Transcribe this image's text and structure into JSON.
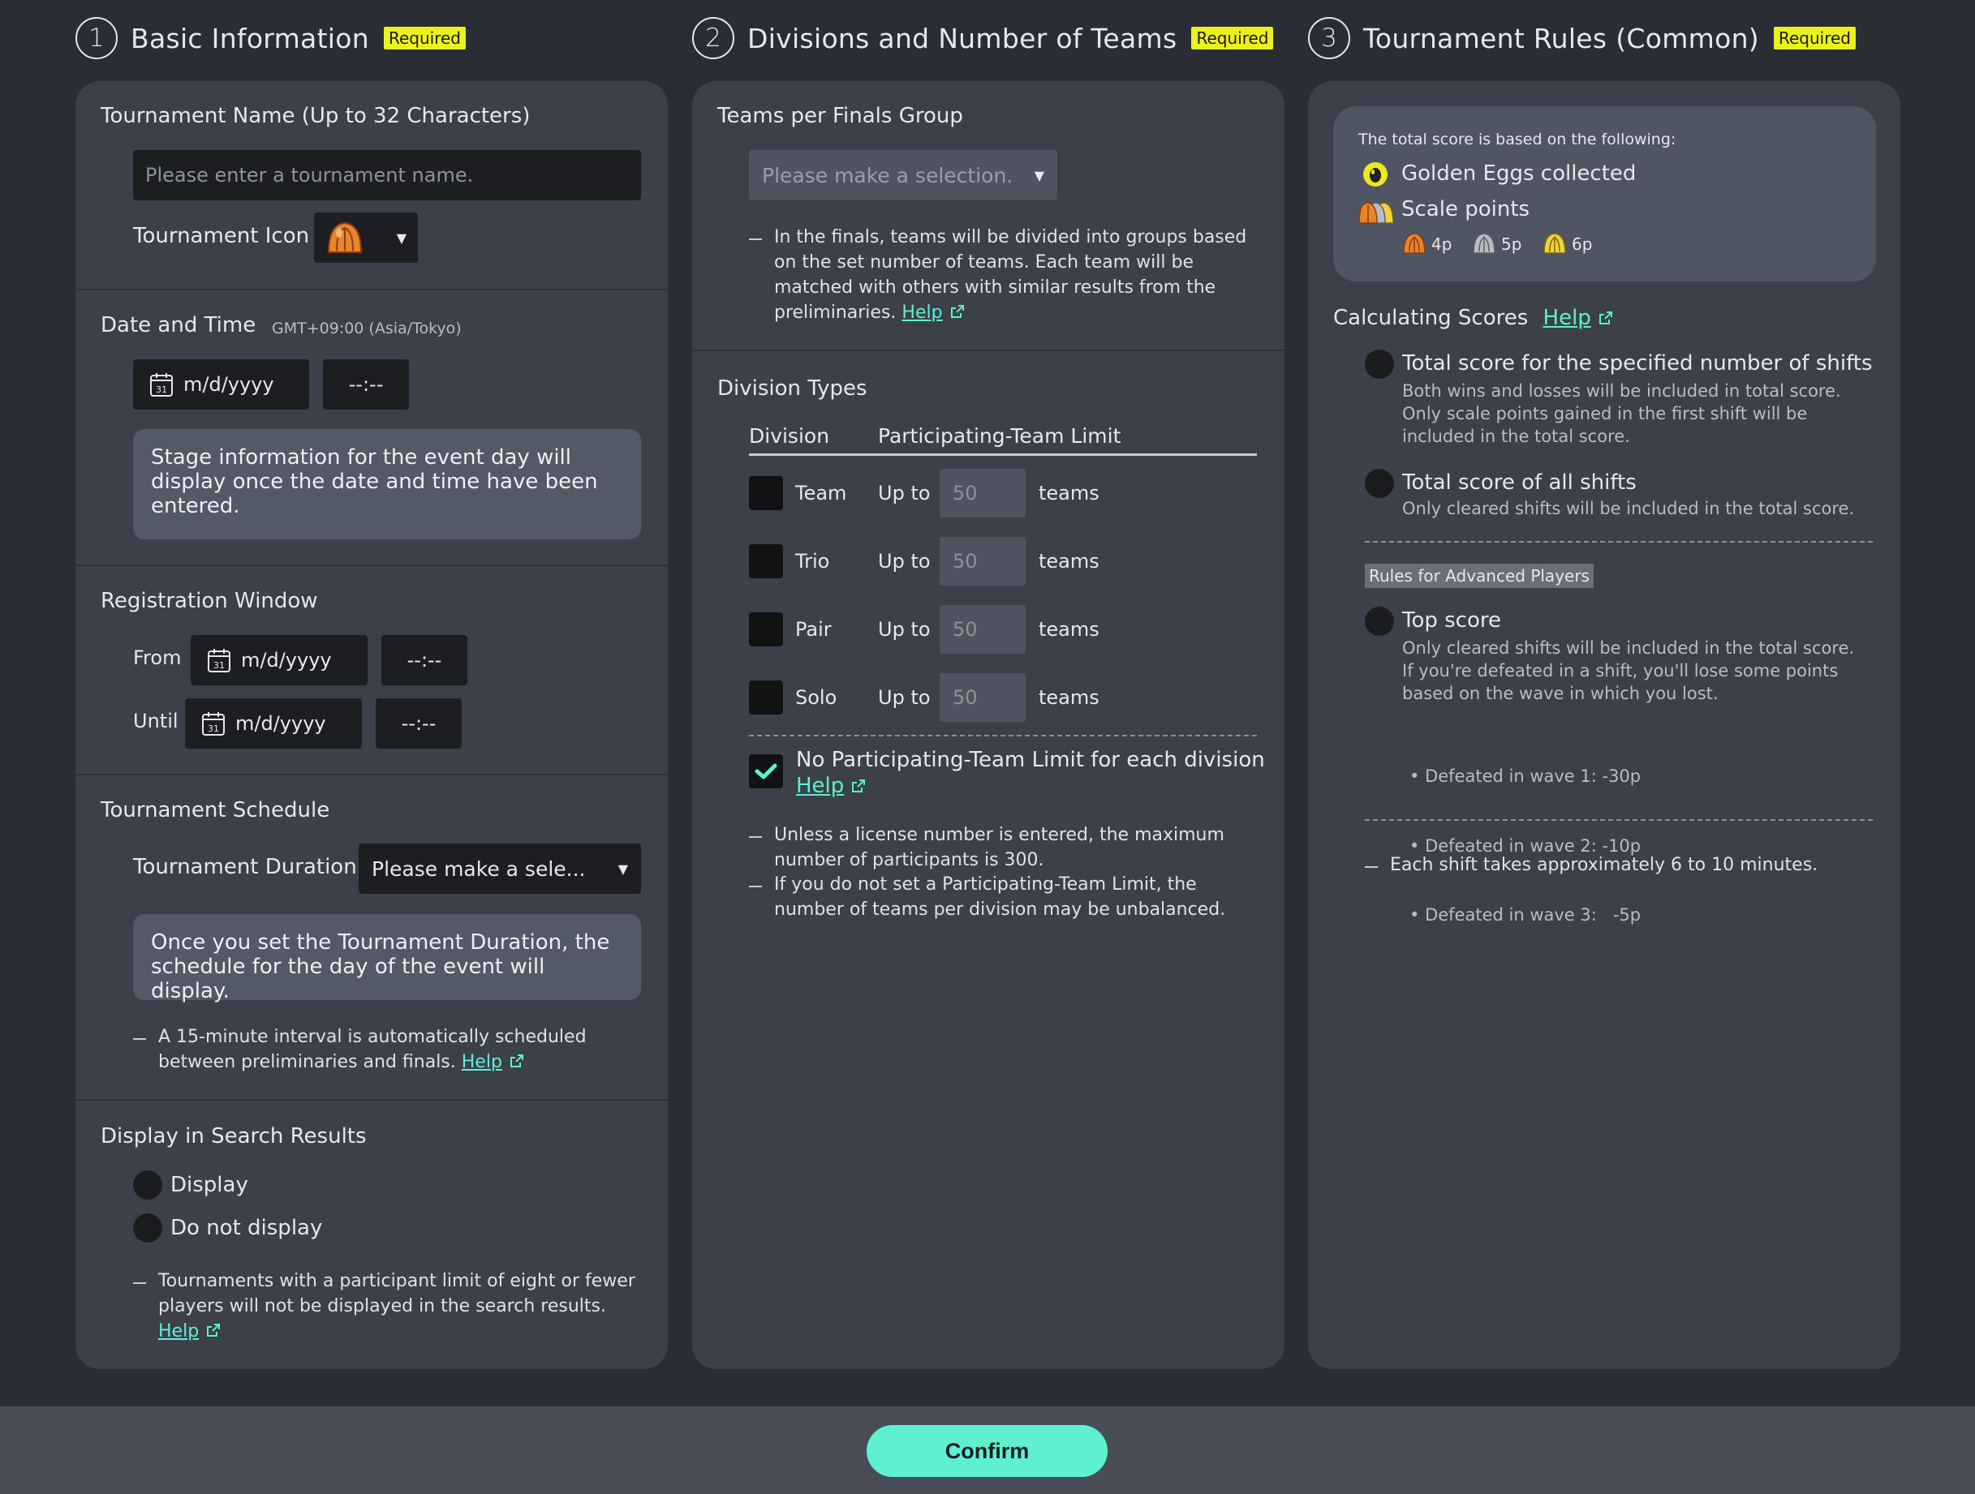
{
  "sections": {
    "s1": {
      "num": "1",
      "title": "Basic Information",
      "required": "Required"
    },
    "s2": {
      "num": "2",
      "title": "Divisions and Number of Teams",
      "required": "Required"
    },
    "s3": {
      "num": "3",
      "title": "Tournament Rules (Common)",
      "required": "Required"
    }
  },
  "basic": {
    "name_label": "Tournament Name (Up to 32 Characters)",
    "name_placeholder": "Please enter a tournament name.",
    "icon_label": "Tournament Icon",
    "date_label": "Date and Time",
    "timezone": "GMT+09:00 (Asia/Tokyo)",
    "date_placeholder": "m/d/yyyy",
    "time_placeholder": "--:--",
    "date_info": "Stage information for the event day will display once the date and time have been entered.",
    "reg_label": "Registration Window",
    "from_label": "From",
    "until_label": "Until",
    "schedule_label": "Tournament Schedule",
    "duration_label": "Tournament Duration",
    "duration_select": "Please make a sele...",
    "schedule_info": "Once you set the Tournament Duration, the schedule for the day of the event will display.",
    "interval_note": "A 15-minute interval is automatically scheduled between preliminaries and finals.",
    "help": "Help",
    "display_label": "Display in Search Results",
    "display_option": "Display",
    "no_display_option": "Do not display",
    "display_note": "Tournaments with a participant limit of eight or fewer players will not be displayed in the search results."
  },
  "divisions": {
    "finals_label": "Teams per Finals Group",
    "finals_select": "Please make a selection.",
    "finals_note": "In the finals, teams will be divided into groups based on the set number of teams. Each team will be matched with others with similar results from the preliminaries.",
    "help": "Help",
    "types_label": "Division Types",
    "col_division": "Division",
    "col_limit": "Participating-Team Limit",
    "up_to": "Up to",
    "teams_unit": "teams",
    "rows": [
      {
        "name": "Team",
        "limit": "50"
      },
      {
        "name": "Trio",
        "limit": "50"
      },
      {
        "name": "Pair",
        "limit": "50"
      },
      {
        "name": "Solo",
        "limit": "50"
      }
    ],
    "no_limit_label": "No Participating-Team Limit for each division",
    "no_limit_checked": true,
    "note1": "Unless a license number is entered, the maximum number of participants is 300.",
    "note2": "If you do not set a Participating-Team Limit, the number of teams per division may be unbalanced."
  },
  "rules": {
    "score_intro": "The total score is based on the following:",
    "golden_eggs": "Golden Eggs collected",
    "scale_points": "Scale points",
    "scale_values": [
      "4p",
      "5p",
      "6p"
    ],
    "calc_label": "Calculating Scores",
    "help": "Help",
    "opt1_title": "Total score for the specified number of shifts",
    "opt1_desc1": "Both wins and losses will be included in total score.",
    "opt1_desc2": "Only scale points gained in the first shift will be included in the total score.",
    "opt2_title": "Total score of all shifts",
    "opt2_desc": "Only cleared shifts will be included in the total score.",
    "advanced_tag": "Rules for Advanced Players",
    "opt3_title": "Top score",
    "opt3_desc1": "Only cleared shifts will be included in the total score.",
    "opt3_desc2": "If you're defeated in a shift, you'll lose some points based on the wave in which you lost.",
    "waves": [
      "Defeated in wave 1: -30p",
      "Defeated in wave 2: -10p",
      "Defeated in wave 3:   -5p"
    ],
    "shift_note": "Each shift takes approximately 6 to 10 minutes."
  },
  "footer": {
    "confirm": "Confirm"
  },
  "colors": {
    "accent": "#5ef0cf",
    "required": "#eaf21a",
    "panel": "#3b404a",
    "background": "#2a2d34"
  },
  "icons": [
    "salmon-scale-icon",
    "golden-egg-icon",
    "calendar-icon",
    "external-link-icon",
    "checkmark-icon"
  ]
}
